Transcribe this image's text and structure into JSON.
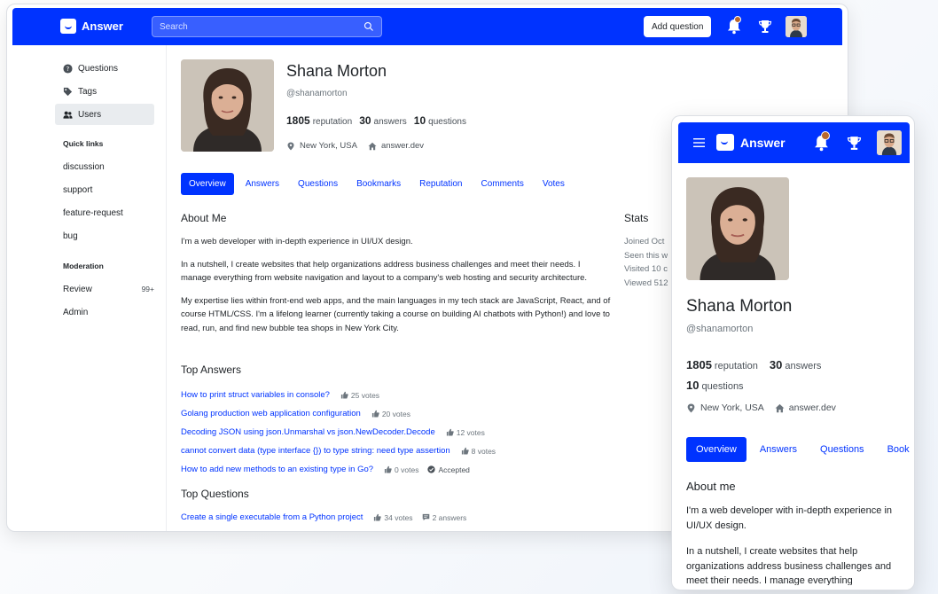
{
  "header": {
    "brand": "Answer",
    "search_placeholder": "Search",
    "add_question": "Add question"
  },
  "sidebar": {
    "items": [
      {
        "label": "Questions",
        "icon": "question-circle-icon"
      },
      {
        "label": "Tags",
        "icon": "tag-icon"
      },
      {
        "label": "Users",
        "icon": "users-icon"
      }
    ],
    "quick_links_heading": "Quick links",
    "quick_links": [
      "discussion",
      "support",
      "feature-request",
      "bug"
    ],
    "moderation_heading": "Moderation",
    "review": "Review",
    "review_badge": "99+",
    "admin": "Admin"
  },
  "profile": {
    "name": "Shana Morton",
    "handle": "@shanamorton",
    "reputation_value": "1805",
    "reputation_label": "reputation",
    "answers_value": "30",
    "answers_label": "answers",
    "questions_value": "10",
    "questions_label": "questions",
    "location": "New York, USA",
    "website": "answer.dev"
  },
  "tabs": [
    "Overview",
    "Answers",
    "Questions",
    "Bookmarks",
    "Reputation",
    "Comments",
    "Votes"
  ],
  "about": {
    "title": "About Me",
    "paragraphs": [
      "I'm a web developer with in-depth experience in UI/UX design.",
      "In a nutshell, I create websites that help organizations address business challenges and meet their needs. I manage everything from website navigation and layout to a company's web hosting and security architecture.",
      "My expertise lies within front-end web apps, and the main languages in my tech stack are JavaScript, React, and of course HTML/CSS. I'm a lifelong learner (currently taking a course on building AI chatbots with Python!) and love to read, run, and find new bubble tea shops in New York City."
    ]
  },
  "stats": {
    "title": "Stats",
    "lines": [
      "Joined Oct",
      "Seen this w",
      "Visited 10 c",
      "Viewed 512"
    ]
  },
  "top_answers": {
    "title": "Top Answers",
    "items": [
      {
        "title": "How to print struct variables in console?",
        "votes": "25 votes",
        "accepted": ""
      },
      {
        "title": "Golang production web application configuration",
        "votes": "20 votes",
        "accepted": ""
      },
      {
        "title": "Decoding JSON using json.Unmarshal vs json.NewDecoder.Decode",
        "votes": "12 votes",
        "accepted": ""
      },
      {
        "title": "cannot convert data (type interface {}) to type string: need type assertion",
        "votes": "8 votes",
        "accepted": ""
      },
      {
        "title": "How to add new methods to an existing type in Go?",
        "votes": "0 votes",
        "accepted": "Accepted"
      }
    ]
  },
  "top_questions": {
    "title": "Top Questions",
    "items": [
      {
        "title": "Create a single executable from a Python project",
        "votes": "34 votes",
        "answers": "2 answers"
      }
    ]
  },
  "mobile": {
    "brand": "Answer",
    "tabs": [
      "Overview",
      "Answers",
      "Questions",
      "Book"
    ],
    "about_title": "About me",
    "about_paragraphs": [
      "I'm a web developer with in-depth experience in UI/UX design.",
      "In a nutshell, I create websites that help organizations address business challenges and meet their needs. I manage everything"
    ]
  },
  "colors": {
    "brand_blue": "#0033ff",
    "notification_dot": "#b8682e"
  }
}
